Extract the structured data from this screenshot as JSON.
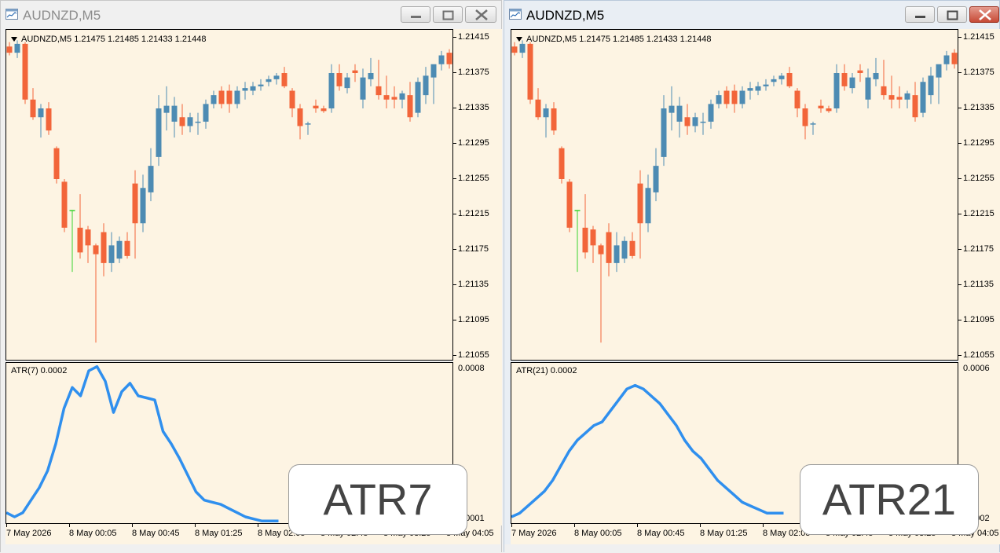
{
  "colors": {
    "bull": "#4d8bb3",
    "bear": "#f2653a",
    "bg": "#fdf4e3",
    "atr": "#2f8fee",
    "tick": "#39d42f"
  },
  "windows": [
    {
      "title": "AUDNZD,M5",
      "active": false,
      "chart_header": "AUDNZD,M5  1.21475 1.21485 1.21433 1.21448",
      "indicator_header": "ATR(7) 0.0002",
      "indicator_axis": [
        "0.0008",
        "0.0001"
      ],
      "badge": "ATR7"
    },
    {
      "title": "AUDNZD,M5",
      "active": true,
      "chart_header": "AUDNZD,M5  1.21475 1.21485 1.21433 1.21448",
      "indicator_header": "ATR(21) 0.0002",
      "indicator_axis": [
        "0.0006",
        "0.0002"
      ],
      "badge": "ATR21"
    }
  ],
  "price_axis": [
    "1.21415",
    "1.21375",
    "1.21335",
    "1.21295",
    "1.21255",
    "1.21215",
    "1.21175",
    "1.21135",
    "1.21095",
    "1.21055"
  ],
  "time_axis": [
    "7 May 2026",
    "8 May 00:05",
    "8 May 00:45",
    "8 May 01:25",
    "8 May 02:05",
    "8 May 02:45",
    "8 May 03:25",
    "8 May 04:05"
  ],
  "chart_data": [
    {
      "type": "candlestick",
      "symbol": "AUDNZD,M5",
      "ylim": [
        1.21055,
        1.2142
      ],
      "candles": [
        [
          1.21405,
          1.2141,
          1.21395,
          1.21398
        ],
        [
          1.21398,
          1.21412,
          1.21392,
          1.21408
        ],
        [
          1.21408,
          1.2141,
          1.2134,
          1.21345
        ],
        [
          1.21345,
          1.21358,
          1.21322,
          1.21325
        ],
        [
          1.21325,
          1.2134,
          1.21302,
          1.21335
        ],
        [
          1.21335,
          1.21342,
          1.21305,
          1.2131
        ],
        [
          1.2129,
          1.21292,
          1.2125,
          1.21255
        ],
        [
          1.21252,
          1.21255,
          1.21195,
          1.212
        ],
        [
          1.2122,
          1.2122,
          1.2115,
          1.2122
        ],
        [
          1.212,
          1.21238,
          1.21165,
          1.21172
        ],
        [
          1.21198,
          1.21202,
          1.2116,
          1.2118
        ],
        [
          1.2118,
          1.21182,
          1.2107,
          1.2117
        ],
        [
          1.21195,
          1.21205,
          1.21145,
          1.2116
        ],
        [
          1.2116,
          1.21195,
          1.2115,
          1.2118
        ],
        [
          1.21165,
          1.2119,
          1.2116,
          1.21185
        ],
        [
          1.21185,
          1.21195,
          1.21165,
          1.21168
        ],
        [
          1.2125,
          1.21265,
          1.21165,
          1.21205
        ],
        [
          1.21205,
          1.2126,
          1.21195,
          1.21245
        ],
        [
          1.2124,
          1.2129,
          1.2123,
          1.2127
        ],
        [
          1.2128,
          1.2135,
          1.2127,
          1.21335
        ],
        [
          1.2133,
          1.2136,
          1.2131,
          1.21338
        ],
        [
          1.2132,
          1.21348,
          1.21302,
          1.21338
        ],
        [
          1.21325,
          1.2134,
          1.21305,
          1.21315
        ],
        [
          1.21315,
          1.2133,
          1.21308,
          1.21325
        ],
        [
          1.2132,
          1.2133,
          1.21305,
          1.2132
        ],
        [
          1.2132,
          1.21345,
          1.21312,
          1.2134
        ],
        [
          1.2134,
          1.21355,
          1.21335,
          1.2135
        ],
        [
          1.21355,
          1.2136,
          1.21335,
          1.2134
        ],
        [
          1.21355,
          1.21362,
          1.2133,
          1.2134
        ],
        [
          1.2134,
          1.2136,
          1.21335,
          1.21355
        ],
        [
          1.21355,
          1.21365,
          1.21345,
          1.21358
        ],
        [
          1.21355,
          1.21365,
          1.2135,
          1.2136
        ],
        [
          1.2136,
          1.21368,
          1.21355,
          1.21362
        ],
        [
          1.21365,
          1.21372,
          1.2136,
          1.21368
        ],
        [
          1.21368,
          1.21375,
          1.21362,
          1.21372
        ],
        [
          1.21375,
          1.21382,
          1.21358,
          1.2136
        ],
        [
          1.21355,
          1.21358,
          1.21325,
          1.21335
        ],
        [
          1.21335,
          1.2134,
          1.213,
          1.21315
        ],
        [
          1.21318,
          1.2132,
          1.21305,
          1.21318
        ],
        [
          1.21338,
          1.21345,
          1.2133,
          1.21335
        ],
        [
          1.21335,
          1.21338,
          1.2133,
          1.21332
        ],
        [
          1.21335,
          1.21385,
          1.2133,
          1.21375
        ],
        [
          1.21375,
          1.21385,
          1.21355,
          1.2136
        ],
        [
          1.21358,
          1.21375,
          1.21352,
          1.2137
        ],
        [
          1.21378,
          1.21385,
          1.21365,
          1.21375
        ],
        [
          1.21345,
          1.2138,
          1.21335,
          1.2137
        ],
        [
          1.21368,
          1.21392,
          1.2136,
          1.21375
        ],
        [
          1.2136,
          1.2139,
          1.21345,
          1.2135
        ],
        [
          1.2135,
          1.21372,
          1.21335,
          1.21345
        ],
        [
          1.21348,
          1.2136,
          1.21335,
          1.21345
        ],
        [
          1.21345,
          1.21355,
          1.21335,
          1.21352
        ],
        [
          1.2135,
          1.21365,
          1.2132,
          1.21325
        ],
        [
          1.2133,
          1.2137,
          1.21325,
          1.21365
        ],
        [
          1.2135,
          1.21382,
          1.2134,
          1.21372
        ],
        [
          1.2137,
          1.2138,
          1.2134,
          1.21385
        ],
        [
          1.21385,
          1.214,
          1.21378,
          1.21395
        ],
        [
          1.21398,
          1.21402,
          1.2138,
          1.21385
        ],
        [
          1.21385,
          1.2139,
          1.21375,
          1.2138
        ]
      ]
    },
    {
      "type": "line",
      "name": "ATR(7)",
      "ylim": [
        0.0001,
        0.0008
      ],
      "values": [
        0.00012,
        0.0001,
        0.00012,
        0.00018,
        0.00024,
        0.00032,
        0.00045,
        0.00062,
        0.00072,
        0.00068,
        0.0008,
        0.00082,
        0.00075,
        0.0006,
        0.0007,
        0.00074,
        0.00068,
        0.00067,
        0.00066,
        0.00051,
        0.00045,
        0.00038,
        0.0003,
        0.00022,
        0.00018,
        0.00017,
        0.00016,
        0.00014,
        0.00012,
        0.0001,
        9e-05,
        8e-05,
        8e-05,
        8e-05
      ]
    },
    {
      "type": "line",
      "name": "ATR(21)",
      "ylim": [
        0.0002,
        0.0006
      ],
      "values": [
        0.0002,
        0.00021,
        0.00023,
        0.00025,
        0.00027,
        0.0003,
        0.00034,
        0.00038,
        0.00041,
        0.00043,
        0.00045,
        0.00046,
        0.00049,
        0.00052,
        0.00055,
        0.00056,
        0.00055,
        0.00053,
        0.00051,
        0.00048,
        0.00045,
        0.00041,
        0.00038,
        0.00036,
        0.00033,
        0.0003,
        0.00028,
        0.00026,
        0.00024,
        0.00023,
        0.00022,
        0.00021,
        0.00021,
        0.00021
      ]
    }
  ]
}
